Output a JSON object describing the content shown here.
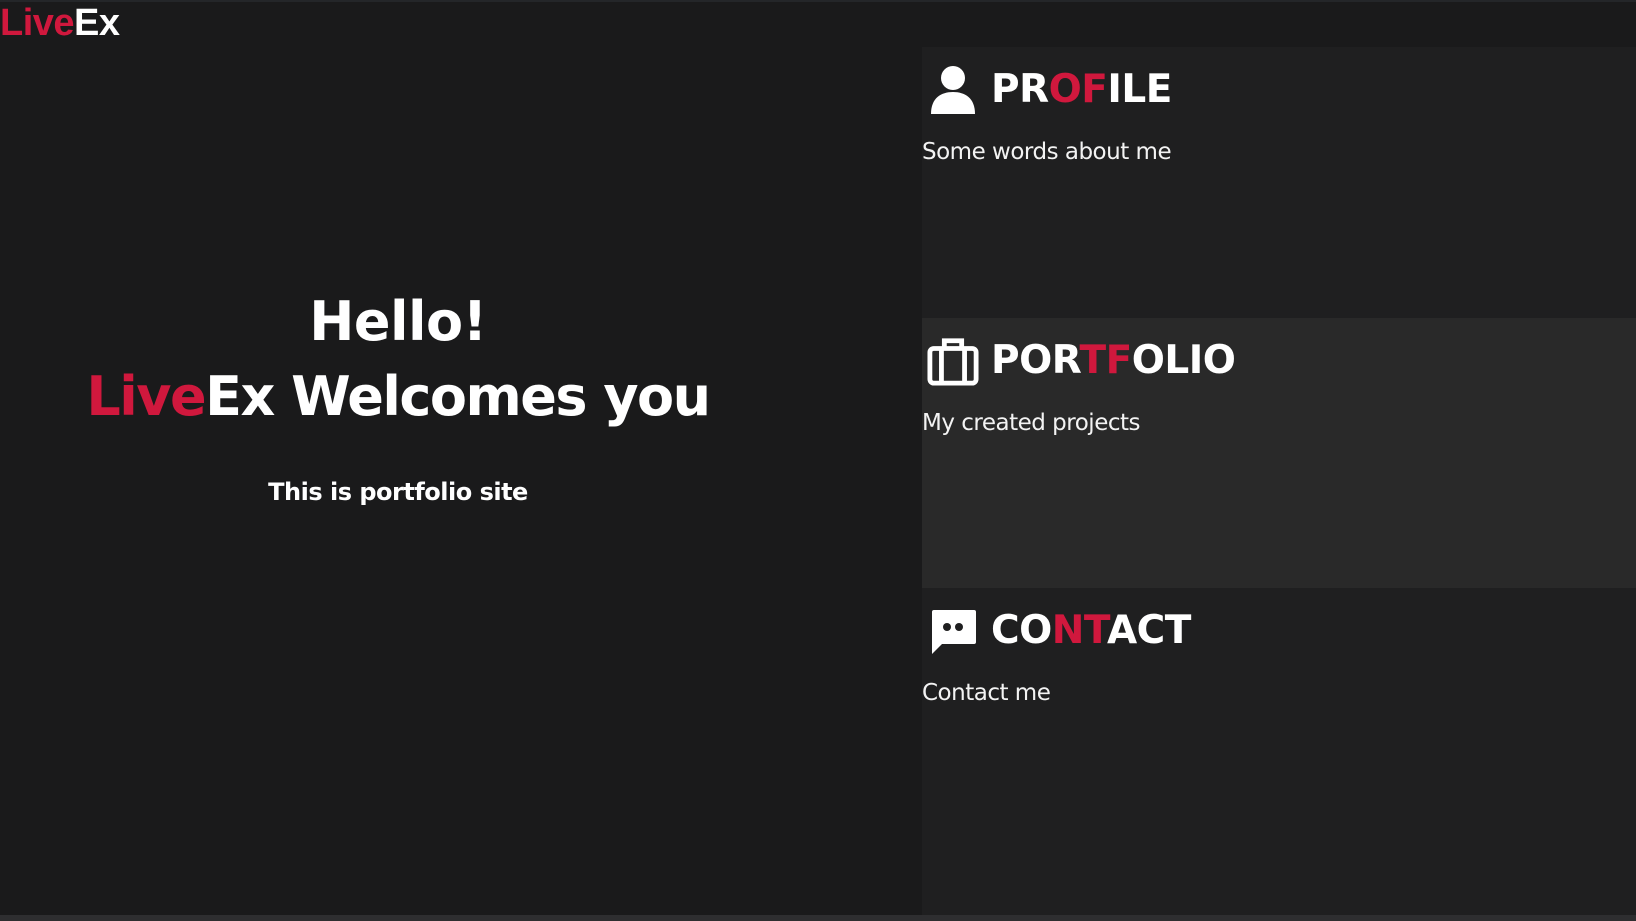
{
  "header": {
    "logo_part1": "Live",
    "logo_part2": "Ex"
  },
  "hero": {
    "greeting": "Hello!",
    "welcome_accent": "Live",
    "welcome_rest": "Ex Welcomes you",
    "subtitle": "This is portfolio site"
  },
  "panels": [
    {
      "icon": "user-icon",
      "title_a": "PR",
      "title_b": "OF",
      "title_c": "ILE",
      "description": "Some words about me"
    },
    {
      "icon": "briefcase-icon",
      "title_a": "POR",
      "title_b": "TF",
      "title_c": "OLIO",
      "description": "My created projects"
    },
    {
      "icon": "chat-icon",
      "title_a": "CO",
      "title_b": "NT",
      "title_c": "ACT",
      "description": "Contact me"
    }
  ],
  "colors": {
    "background": "#1a1a1b",
    "panel": "#1f1f20",
    "panel_alt": "#292929",
    "accent": "#d0183d",
    "text": "#ffffff"
  }
}
